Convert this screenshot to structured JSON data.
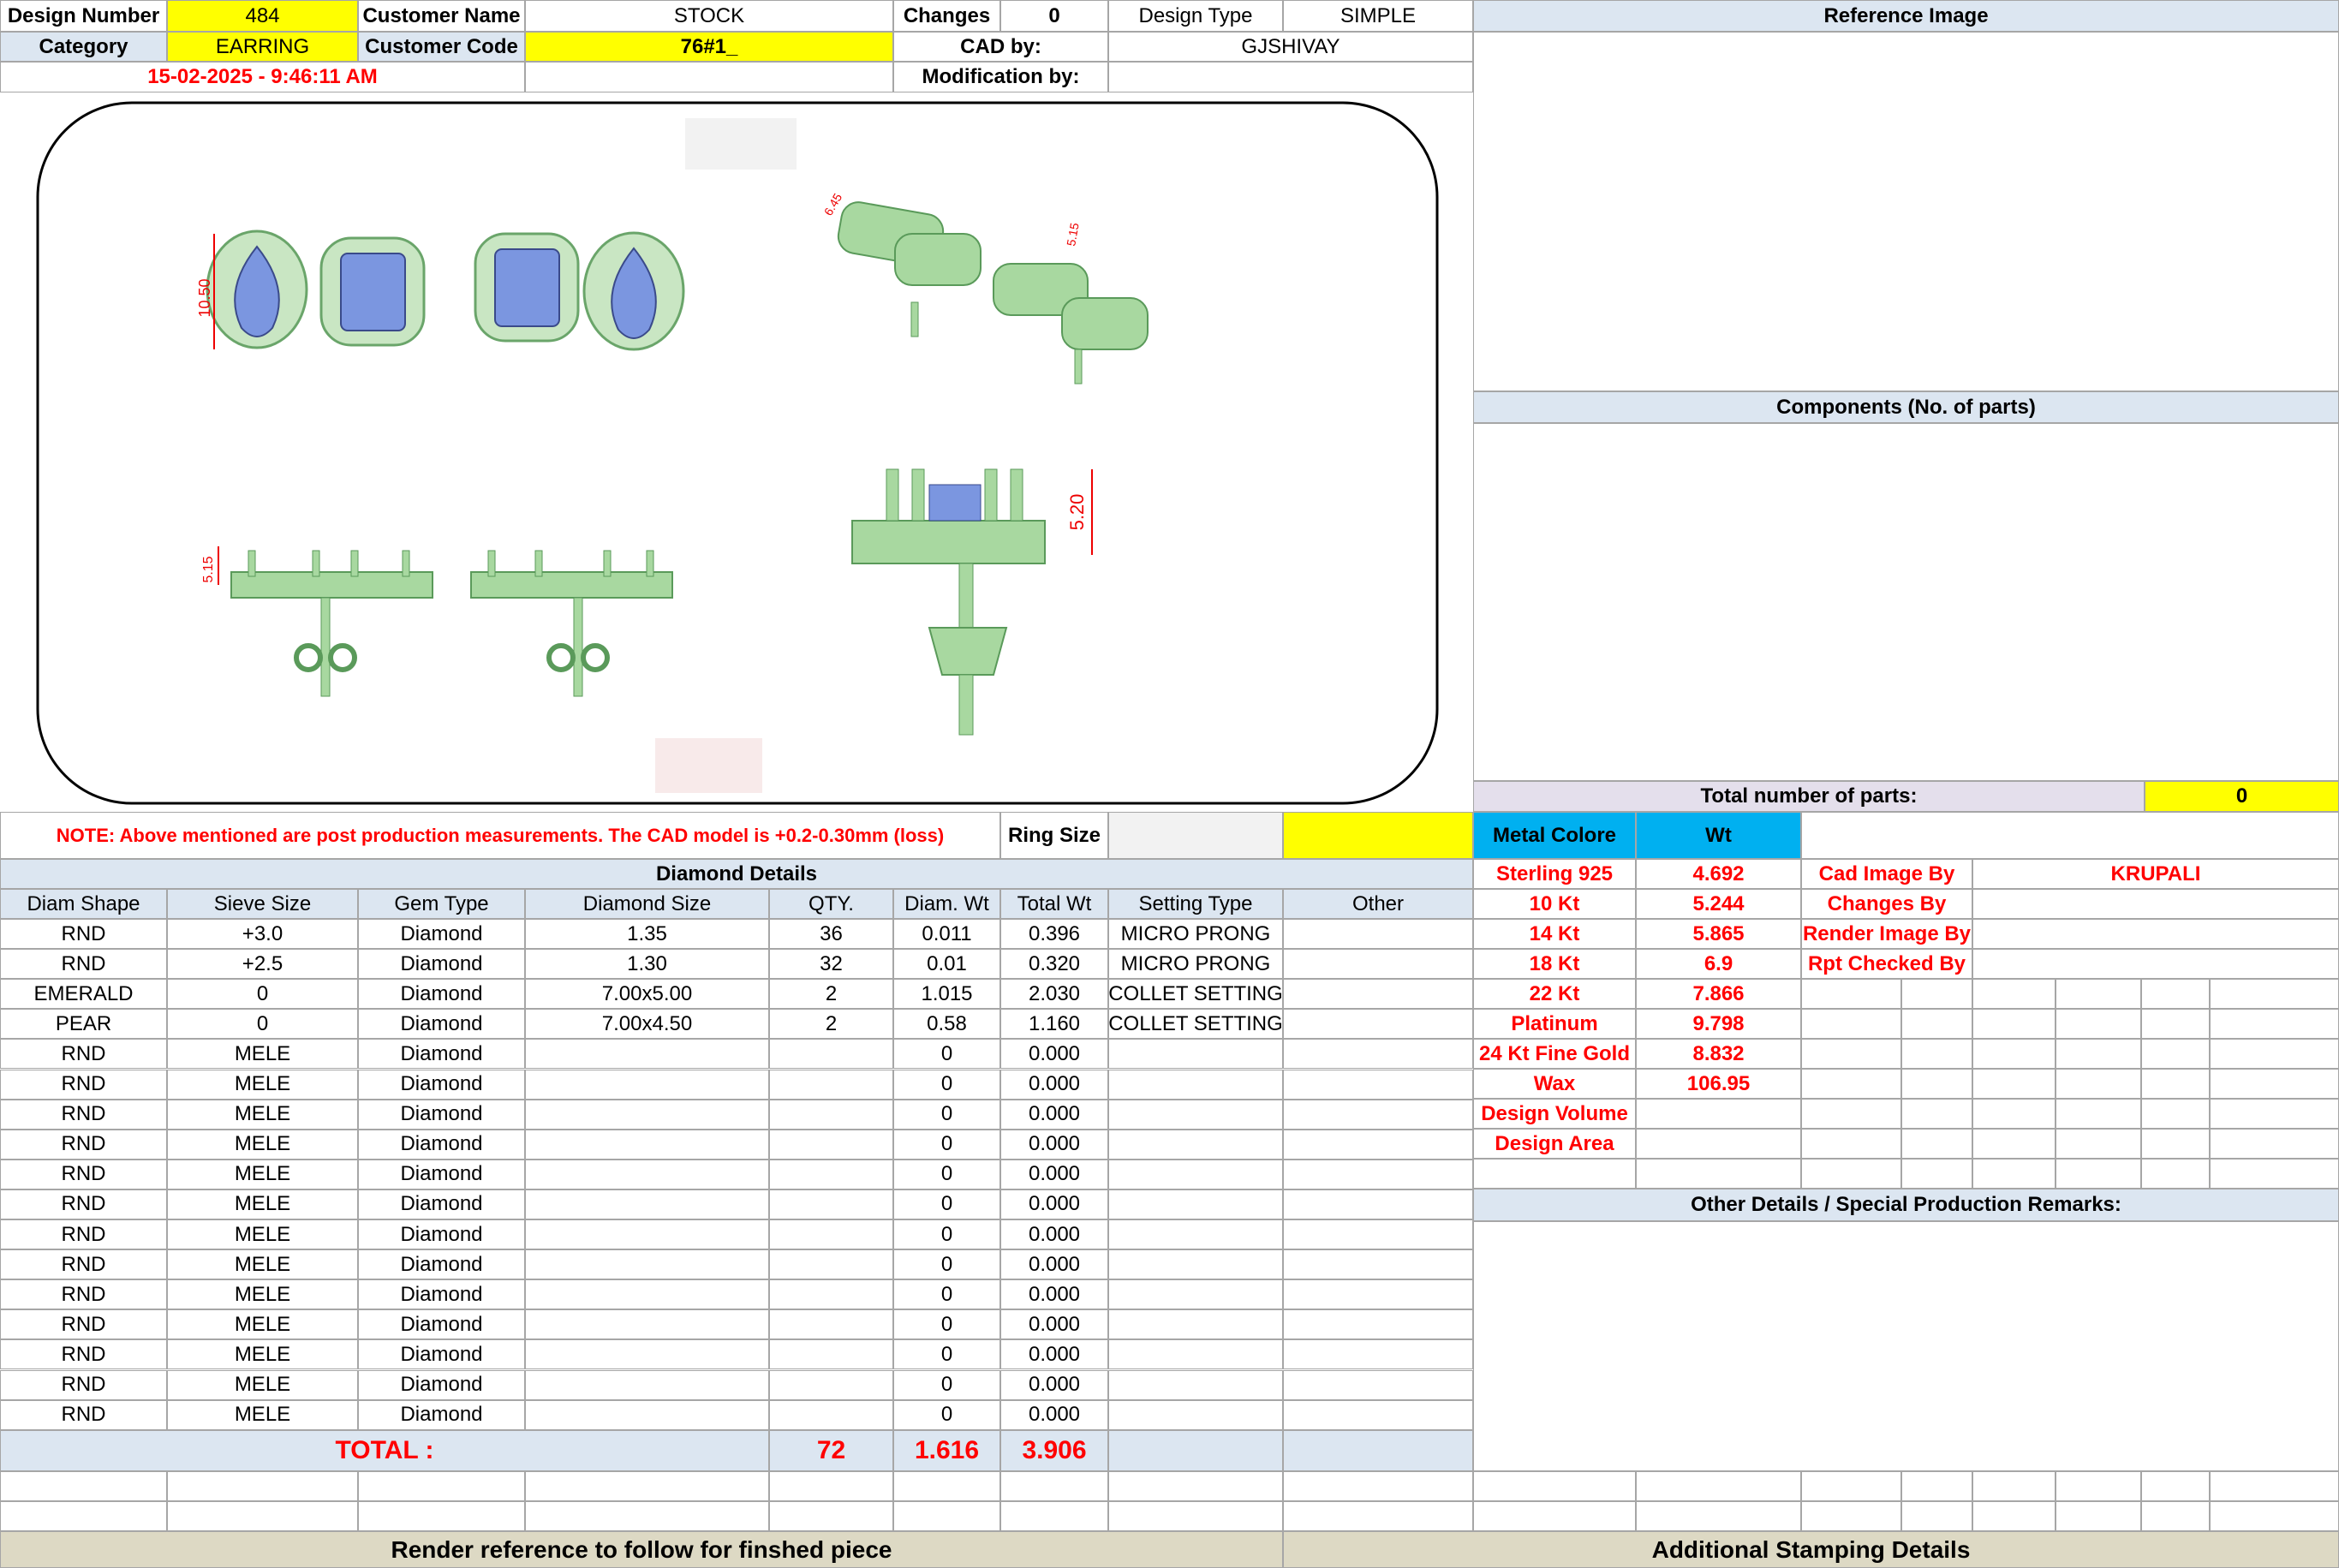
{
  "header": {
    "design_number_label": "Design Number",
    "design_number": "484",
    "customer_name_label": "Customer Name",
    "customer_name": "STOCK",
    "changes_label": "Changes",
    "changes": "0",
    "design_type_label": "Design Type",
    "design_type": "SIMPLE",
    "category_label": "Category",
    "category": "EARRING",
    "customer_code_label": "Customer Code",
    "customer_code": "76#1_",
    "cad_by_label": "CAD by:",
    "cad_by": "GJSHIVAY",
    "date": "15-02-2025 - 9:46:11 AM",
    "modification_label": "Modification by:"
  },
  "right_panel": {
    "reference_image": "Reference Image",
    "components": "Components (No. of parts)",
    "total_parts_label": "Total number of parts:",
    "total_parts": "0",
    "metal_colore": "Metal Colore",
    "wt": "Wt",
    "metals": [
      {
        "name": "Sterling 925",
        "wt": "4.692"
      },
      {
        "name": "10 Kt",
        "wt": "5.244"
      },
      {
        "name": "14 Kt",
        "wt": "5.865"
      },
      {
        "name": "18 Kt",
        "wt": "6.9"
      },
      {
        "name": "22 Kt",
        "wt": "7.866"
      },
      {
        "name": "Platinum",
        "wt": "9.798"
      },
      {
        "name": "24 Kt Fine Gold",
        "wt": "8.832"
      },
      {
        "name": "Wax",
        "wt": "106.95"
      },
      {
        "name": "Design Volume",
        "wt": ""
      },
      {
        "name": "Design Area",
        "wt": ""
      }
    ],
    "cad_image_by_label": "Cad Image By",
    "cad_image_by": "KRUPALI",
    "changes_by_label": "Changes By",
    "render_image_by_label": "Render Image By",
    "rpt_checked_by_label": "Rpt Checked By",
    "other_details": "Other Details / Special Production Remarks:"
  },
  "drawing": {
    "dim_top": "10.50",
    "dim_top_right_1": "6.45",
    "dim_top_right_2": "5.15",
    "dim_side": "5.15",
    "dim_side_big": "5.20"
  },
  "note": "NOTE: Above mentioned are post production measurements. The CAD model is +0.2-0.30mm (loss)",
  "ring_size_label": "Ring Size",
  "diamond": {
    "title": "Diamond Details",
    "headers": [
      "Diam Shape",
      "Sieve Size",
      "Gem Type",
      "Diamond Size",
      "QTY.",
      "Diam. Wt",
      "Total Wt",
      "Setting Type",
      "Other"
    ],
    "rows": [
      [
        "RND",
        "+3.0",
        "Diamond",
        "1.35",
        "36",
        "0.011",
        "0.396",
        "MICRO PRONG",
        ""
      ],
      [
        "RND",
        "+2.5",
        "Diamond",
        "1.30",
        "32",
        "0.01",
        "0.320",
        "MICRO PRONG",
        ""
      ],
      [
        "EMERALD",
        "0",
        "Diamond",
        "7.00x5.00",
        "2",
        "1.015",
        "2.030",
        "COLLET SETTING",
        ""
      ],
      [
        "PEAR",
        "0",
        "Diamond",
        "7.00x4.50",
        "2",
        "0.58",
        "1.160",
        "COLLET SETTING",
        ""
      ],
      [
        "RND",
        "MELE",
        "Diamond",
        "",
        "",
        "0",
        "0.000",
        "",
        ""
      ],
      [
        "RND",
        "MELE",
        "Diamond",
        "",
        "",
        "0",
        "0.000",
        "",
        ""
      ],
      [
        "RND",
        "MELE",
        "Diamond",
        "",
        "",
        "0",
        "0.000",
        "",
        ""
      ],
      [
        "RND",
        "MELE",
        "Diamond",
        "",
        "",
        "0",
        "0.000",
        "",
        ""
      ],
      [
        "RND",
        "MELE",
        "Diamond",
        "",
        "",
        "0",
        "0.000",
        "",
        ""
      ],
      [
        "RND",
        "MELE",
        "Diamond",
        "",
        "",
        "0",
        "0.000",
        "",
        ""
      ],
      [
        "RND",
        "MELE",
        "Diamond",
        "",
        "",
        "0",
        "0.000",
        "",
        ""
      ],
      [
        "RND",
        "MELE",
        "Diamond",
        "",
        "",
        "0",
        "0.000",
        "",
        ""
      ],
      [
        "RND",
        "MELE",
        "Diamond",
        "",
        "",
        "0",
        "0.000",
        "",
        ""
      ],
      [
        "RND",
        "MELE",
        "Diamond",
        "",
        "",
        "0",
        "0.000",
        "",
        ""
      ],
      [
        "RND",
        "MELE",
        "Diamond",
        "",
        "",
        "0",
        "0.000",
        "",
        ""
      ],
      [
        "RND",
        "MELE",
        "Diamond",
        "",
        "",
        "0",
        "0.000",
        "",
        ""
      ],
      [
        "RND",
        "MELE",
        "Diamond",
        "",
        "",
        "0",
        "0.000",
        "",
        ""
      ]
    ],
    "total_label": "TOTAL :",
    "total_qty": "72",
    "total_diam_wt": "1.616",
    "total_wt": "3.906"
  },
  "footer": {
    "render_ref": "Render reference to follow for finshed piece",
    "stamping": "Additional Stamping Details"
  }
}
